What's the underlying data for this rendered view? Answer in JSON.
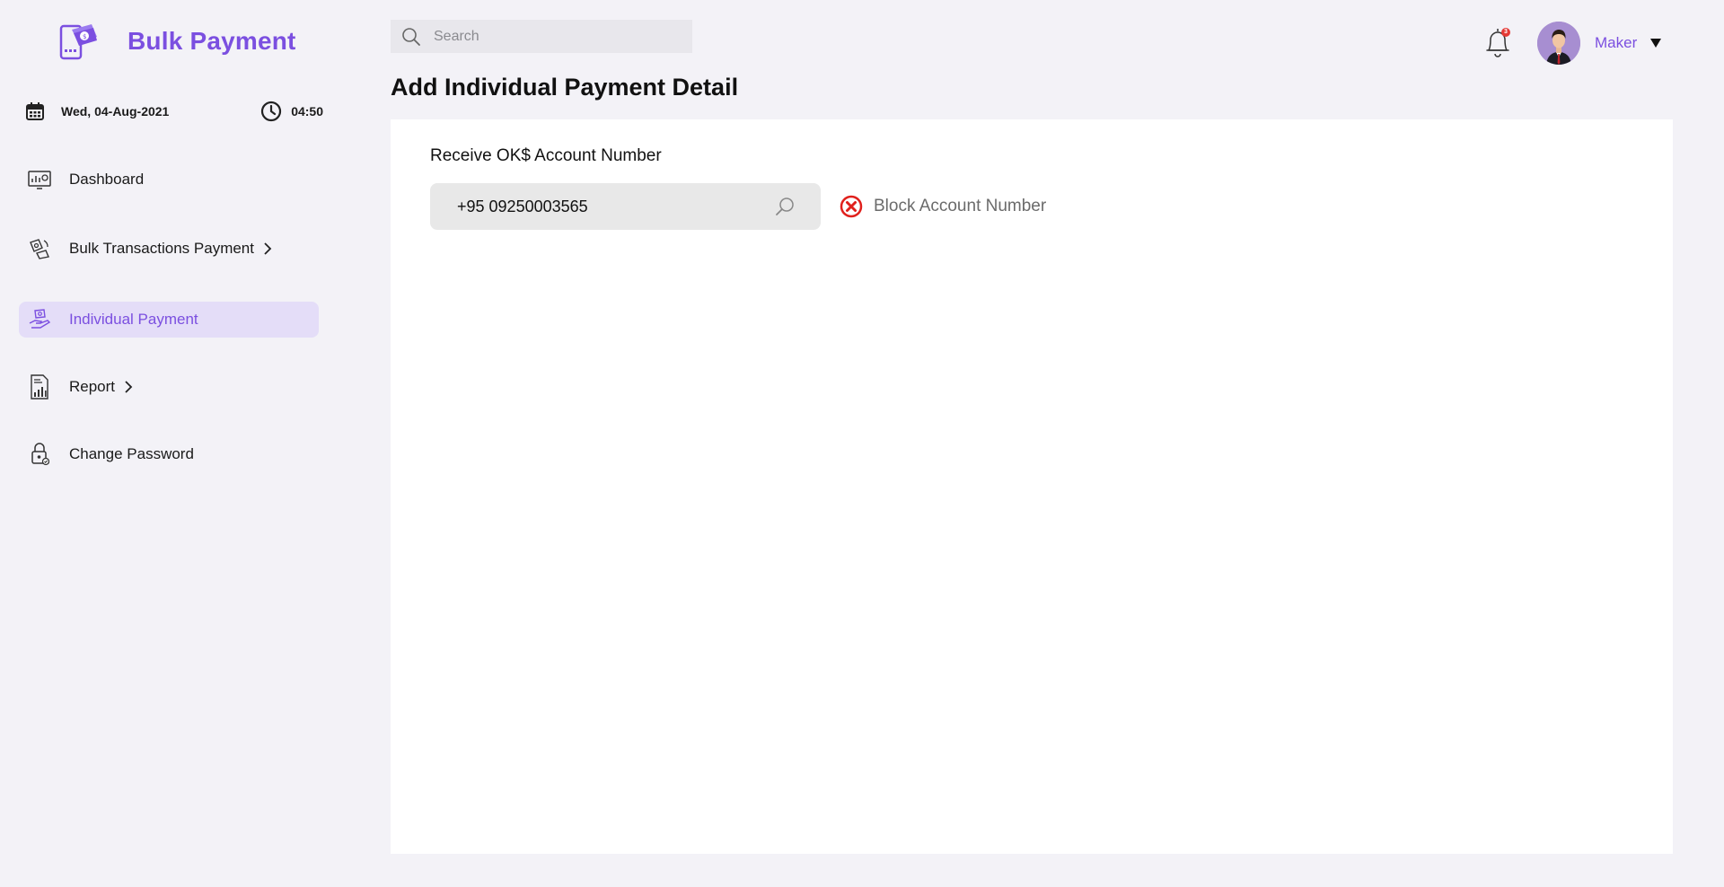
{
  "brand": {
    "title": "Bulk Payment",
    "logo_icon": "wallet-phone-icon",
    "accent_color": "#7b4fe0"
  },
  "datetime": {
    "date": "Wed, 04-Aug-2021",
    "time": "04:50"
  },
  "sidebar": {
    "items": [
      {
        "label": "Dashboard",
        "icon": "dashboard-icon",
        "has_submenu": false,
        "active": false
      },
      {
        "label": "Bulk Transactions Payment",
        "icon": "transactions-icon",
        "has_submenu": true,
        "active": false
      },
      {
        "label": "Individual Payment",
        "icon": "individual-payment-icon",
        "has_submenu": false,
        "active": true
      },
      {
        "label": "Report",
        "icon": "report-icon",
        "has_submenu": true,
        "active": false
      },
      {
        "label": "Change Password",
        "icon": "lock-icon",
        "has_submenu": false,
        "active": false
      }
    ]
  },
  "header": {
    "search_placeholder": "Search",
    "notification_count": "3",
    "user_name": "Maker"
  },
  "main": {
    "title": "Add Individual Payment Detail",
    "field_label": "Receive OK$ Account Number",
    "account_value": "+95 09250003565",
    "block_label": "Block Account Number",
    "block_color": "#e0201c"
  }
}
